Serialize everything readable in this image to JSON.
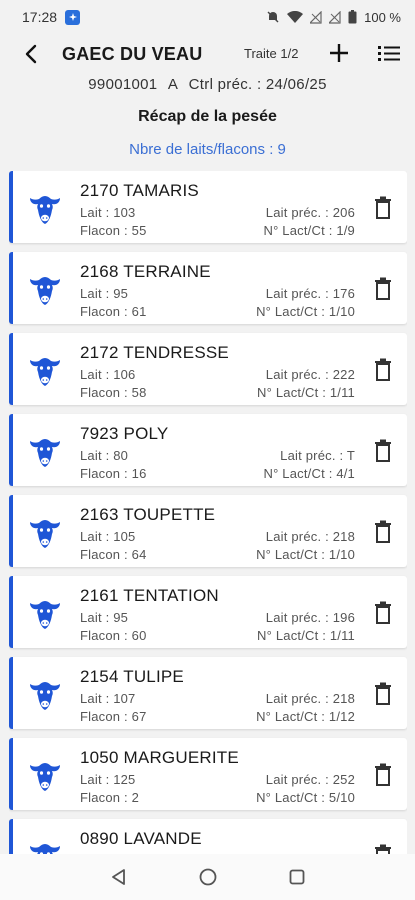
{
  "status_bar": {
    "time": "17:28",
    "battery": "100 %"
  },
  "toolbar": {
    "title": "GAEC DU VEAU",
    "traite": "Traite 1/2"
  },
  "header": {
    "id": "99001001",
    "code": "A",
    "ctrl": "Ctrl préc. : 24/06/25",
    "recap_title": "Récap de la pesée",
    "count_label": "Nbre de laits/flacons : 9"
  },
  "colors": {
    "accent": "#1f56d6",
    "link": "#3b6fd4"
  },
  "cards": [
    {
      "name": "2170 TAMARIS",
      "lait": "Lait : 103",
      "flacon": "Flacon : 55",
      "lait_prec": "Lait préc. : 206",
      "lact": "N° Lact/Ct : 1/9"
    },
    {
      "name": "2168 TERRAINE",
      "lait": "Lait : 95",
      "flacon": "Flacon : 61",
      "lait_prec": "Lait préc. : 176",
      "lact": "N° Lact/Ct : 1/10"
    },
    {
      "name": "2172 TENDRESSE",
      "lait": "Lait : 106",
      "flacon": "Flacon : 58",
      "lait_prec": "Lait préc. : 222",
      "lact": "N° Lact/Ct : 1/11"
    },
    {
      "name": "7923 POLY",
      "lait": "Lait : 80",
      "flacon": "Flacon : 16",
      "lait_prec": "Lait préc. : T",
      "lact": "N° Lact/Ct : 4/1"
    },
    {
      "name": "2163 TOUPETTE",
      "lait": "Lait : 105",
      "flacon": "Flacon : 64",
      "lait_prec": "Lait préc. : 218",
      "lact": "N° Lact/Ct : 1/10"
    },
    {
      "name": "2161 TENTATION",
      "lait": "Lait : 95",
      "flacon": "Flacon : 60",
      "lait_prec": "Lait préc. : 196",
      "lact": "N° Lact/Ct : 1/11"
    },
    {
      "name": "2154 TULIPE",
      "lait": "Lait : 107",
      "flacon": "Flacon : 67",
      "lait_prec": "Lait préc. : 218",
      "lact": "N° Lact/Ct : 1/12"
    },
    {
      "name": "1050 MARGUERITE",
      "lait": "Lait : 125",
      "flacon": "Flacon : 2",
      "lait_prec": "Lait préc. : 252",
      "lact": "N° Lact/Ct : 5/10"
    },
    {
      "name": "0890 LAVANDE",
      "lait": "",
      "flacon": "",
      "lait_prec": "",
      "lact": ""
    }
  ]
}
